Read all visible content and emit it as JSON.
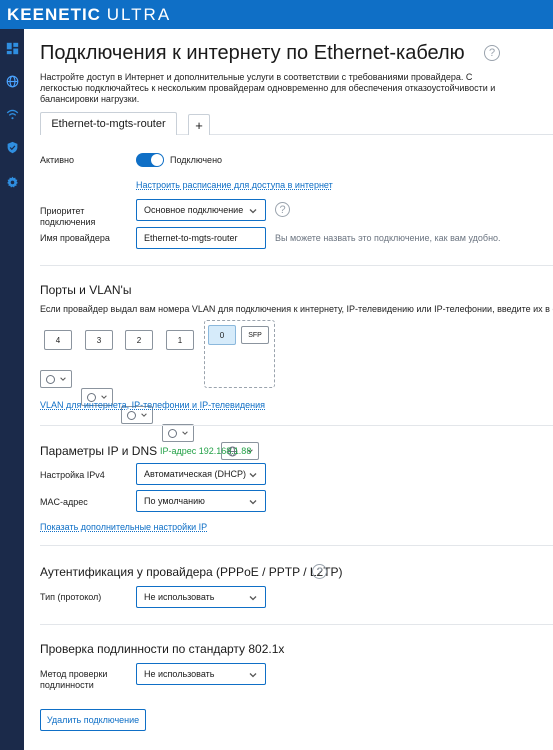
{
  "brand": {
    "name_bold": "KEENETIC",
    "name_light": "ULTRA"
  },
  "sidebar": {
    "items": [
      {
        "icon": "dashboard-icon",
        "active": false
      },
      {
        "icon": "globe-icon",
        "active": true
      },
      {
        "icon": "wifi-icon",
        "active": false
      },
      {
        "icon": "shield-icon",
        "active": false
      },
      {
        "icon": "gear-icon",
        "active": false
      }
    ]
  },
  "page": {
    "title": "Подключения к интернету по Ethernet-кабелю",
    "help": "?",
    "description": "Настройте доступ в Интернет и дополнительные услуги в соответствии с требованиями провайдера. С легкостью подключайтесь к нескольким провайдерам одновременно для обеспечения отказоустойчивости и балансировки нагрузки."
  },
  "tabs": [
    {
      "label": "Ethernet-to-mgts-router",
      "active": true
    },
    {
      "label": "+",
      "active": false
    }
  ],
  "general": {
    "active_label": "Активно",
    "active_state": "Подключено",
    "schedule_link": "Настроить расписание для доступа в интернет",
    "priority_label": "Приоритет подключения",
    "priority_value": "Основное подключение",
    "priority_help": "?",
    "provider_label": "Имя провайдера",
    "provider_value": "Ethernet-to-mgts-router",
    "provider_hint": "Вы можете назвать это подключение, как вам удобно."
  },
  "ports": {
    "title": "Порты и VLAN'ы",
    "description": "Если провайдер выдал вам номера VLAN для подключения к интернету, IP-телевидению или IP-телефонии, введите их в соответствующие поля.",
    "lan_ports": [
      "4",
      "3",
      "2",
      "1"
    ],
    "wan_port": "0",
    "sfp_label": "SFP",
    "vlan_link": "VLAN для интернета, IP-телефонии и IP-телевидения"
  },
  "ip": {
    "title": "Параметры IP и DNS",
    "address_text": "IP-адрес 192.168.1.88",
    "ipv4_label": "Настройка IPv4",
    "ipv4_value": "Автоматическая (DHCP)",
    "mac_label": "MAC-адрес",
    "mac_value": "По умолчанию",
    "more_link": "Показать дополнительные настройки IP"
  },
  "auth": {
    "title": "Аутентификация у провайдера (PPPoE / PPTP / L2TP)",
    "help": "?",
    "type_label": "Тип (протокол)",
    "type_value": "Не использовать"
  },
  "dot1x": {
    "title": "Проверка подлинности по стандарту 802.1x",
    "method_label": "Метод проверки подлинности",
    "method_value": "Не использовать"
  },
  "actions": {
    "delete_label": "Удалить подключение"
  },
  "colors": {
    "accent": "#0f6fc6",
    "sidebar": "#1b2a4a",
    "ok": "#24a148"
  }
}
